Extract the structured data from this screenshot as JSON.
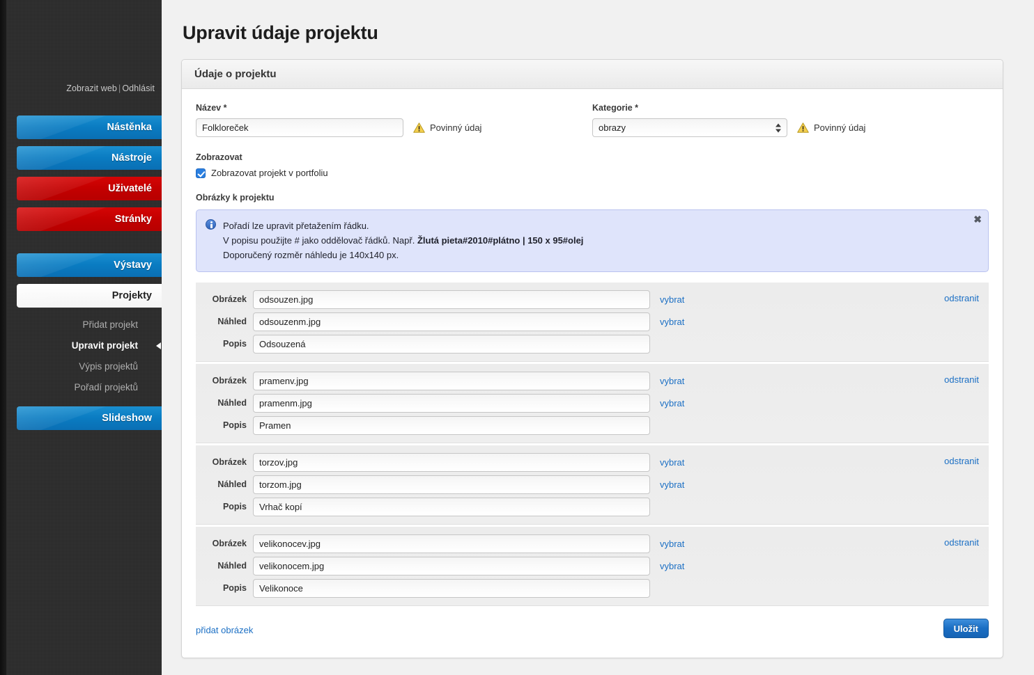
{
  "sidebar": {
    "top_links": {
      "view_site": "Zobrazit web",
      "separator": "|",
      "logout": "Odhlásit"
    },
    "nav": [
      {
        "label": "Nástěnka",
        "style": "blue"
      },
      {
        "label": "Nástroje",
        "style": "blue"
      },
      {
        "label": "Uživatelé",
        "style": "red"
      },
      {
        "label": "Stránky",
        "style": "red"
      },
      {
        "label": "Výstavy",
        "style": "blue"
      },
      {
        "label": "Projekty",
        "style": "white"
      }
    ],
    "subitems": [
      {
        "label": "Přidat projekt",
        "active": false
      },
      {
        "label": "Upravit projekt",
        "active": true
      },
      {
        "label": "Výpis projektů",
        "active": false
      },
      {
        "label": "Pořadí projektů",
        "active": false
      }
    ],
    "nav_last": {
      "label": "Slideshow",
      "style": "blue"
    }
  },
  "page": {
    "title": "Upravit údaje projektu"
  },
  "panel": {
    "title": "Údaje o projektu"
  },
  "form": {
    "name_label": "Název *",
    "name_value": "Folkloreček",
    "name_required_text": "Povinný údaj",
    "category_label": "Kategorie *",
    "category_value": "obrazy",
    "category_options": [
      "obrazy"
    ],
    "category_required_text": "Povinný údaj",
    "display_label": "Zobrazovat",
    "display_checkbox_label": "Zobrazovat projekt v portfoliu",
    "display_checked": true,
    "images_label": "Obrázky k projektu"
  },
  "info": {
    "line1": "Pořadí lze upravit přetažením řádku.",
    "line2_pre": "V popisu použijte # jako oddělovač řádků. Např. ",
    "line2_bold": "Žlutá pieta#2010#plátno | 150 x 95#olej",
    "line3": "Doporučený rozměr náhledu je 140x140 px.",
    "close_glyph": "✖"
  },
  "labels": {
    "image": "Obrázek",
    "thumb": "Náhled",
    "caption": "Popis",
    "pick": "vybrat",
    "delete": "odstranit"
  },
  "image_rows": [
    {
      "image": "odsouzen.jpg",
      "thumb": "odsouzenm.jpg",
      "caption": "Odsouzená"
    },
    {
      "image": "pramenv.jpg",
      "thumb": "pramenm.jpg",
      "caption": "Pramen"
    },
    {
      "image": "torzov.jpg",
      "thumb": "torzom.jpg",
      "caption": "Vrhač kopí"
    },
    {
      "image": "velikonocev.jpg",
      "thumb": "velikonocem.jpg",
      "caption": "Velikonoce"
    }
  ],
  "footer": {
    "add_image": "přidat obrázek",
    "save": "Uložit"
  },
  "colors": {
    "accent_blue": "#1b6fc4",
    "nav_blue": "#0a7cc2",
    "nav_red": "#c40000",
    "info_bg": "#dfe4fb",
    "warn_yellow": "#f2cc4b"
  }
}
